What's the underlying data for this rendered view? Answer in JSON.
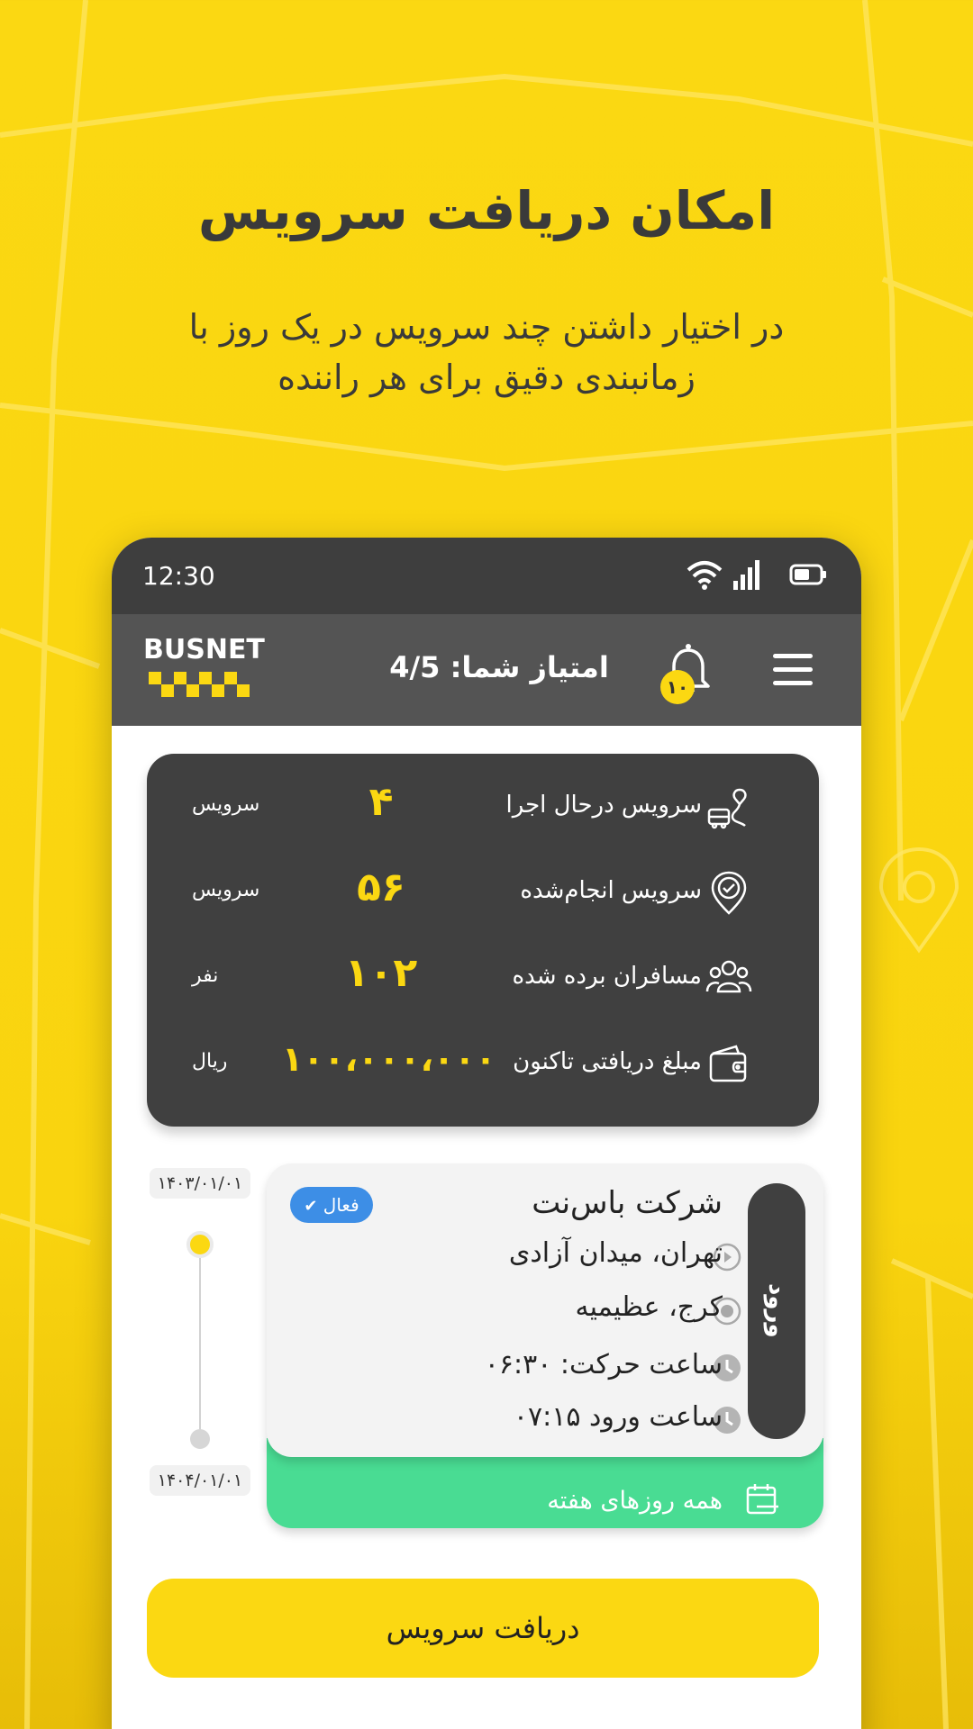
{
  "headline": "امکان دریافت سرویس",
  "subtitle_line1": "در اختیار داشتن چند سرویس در یک روز با",
  "subtitle_line2": "زمانبندی دقیق برای هر راننده",
  "status_bar": {
    "time": "12:30",
    "icons": [
      "wifi-icon",
      "signal-icon",
      "battery-icon"
    ]
  },
  "app_bar": {
    "logo_text": "BUSNET",
    "score_text": "امتیاز شما: 4/5",
    "notification_count": "۱۰",
    "icons": [
      "bell-icon",
      "menu-icon"
    ]
  },
  "stats": [
    {
      "label": "سرویس درحال اجرا",
      "value": "۴",
      "unit": "سرویس",
      "icon": "bus-route-icon"
    },
    {
      "label": "سرویس انجام‌شده",
      "value": "۵۶",
      "unit": "سرویس",
      "icon": "location-check-icon"
    },
    {
      "label": "مسافران برده شده",
      "value": "۱۰۲",
      "unit": "نفر",
      "icon": "people-icon"
    },
    {
      "label": "مبلغ دریافتی تاکنون",
      "value": "۱۰۰،۰۰۰،۰۰۰",
      "unit": "ریال",
      "icon": "wallet-icon"
    }
  ],
  "timeline": {
    "start_date": "۱۴۰۳/۰۱/۰۱",
    "end_date": "۱۴۰۴/۰۱/۰۱"
  },
  "service_card": {
    "company": "شرکت باس‌نت",
    "status_badge": "فعال",
    "origin": "تهران، میدان آزادی",
    "destination": "کرج، عظیمیه",
    "departure": "ساعت حرکت: ۰۶:۳۰",
    "arrival": "ساعت ورود ۰۷:۱۵",
    "enter_label": "ورود",
    "schedule": "همه روزهای هفته"
  },
  "cta_label": "دریافت سرویس",
  "colors": {
    "brand_yellow": "#fbd812",
    "dark": "#404040",
    "green": "#49dc93",
    "badge_blue": "#3d8ee6"
  }
}
